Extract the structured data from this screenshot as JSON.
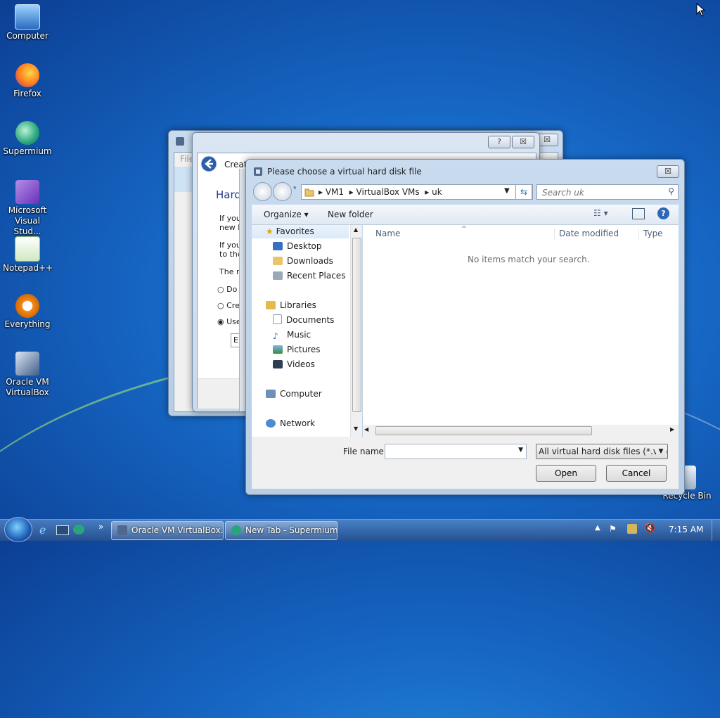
{
  "desktop": {
    "icons": [
      {
        "label": "Computer"
      },
      {
        "label": "Firefox"
      },
      {
        "label": "Supermium"
      },
      {
        "label": "Microsoft Visual Stud..."
      },
      {
        "label": "Notepad++"
      },
      {
        "label": "Everything"
      },
      {
        "label": "Oracle VM VirtualBox"
      },
      {
        "label": "Recycle Bin"
      }
    ]
  },
  "back_window": {
    "title": "Create",
    "heading": "Hard",
    "text_1a": "If you",
    "text_1b": "new h",
    "text_2a": "If you",
    "text_2b": "to the",
    "text_3": "The re",
    "radio_1": "Do",
    "radio_2": "Cre",
    "radio_3": "Use",
    "button_partial": "Em",
    "help": "?",
    "close": "☒",
    "menu_partial": "File"
  },
  "dialog": {
    "title": "Please choose a virtual hard disk file",
    "close": "☒",
    "breadcrumb": [
      "VM1",
      "VirtualBox VMs",
      "uk"
    ],
    "search_placeholder": "Search uk",
    "toolbar": {
      "organize": "Organize ▾",
      "new_folder": "New folder"
    },
    "nav": {
      "favorites": "Favorites",
      "desktop": "Desktop",
      "downloads": "Downloads",
      "recent": "Recent Places",
      "libraries": "Libraries",
      "documents": "Documents",
      "music": "Music",
      "pictures": "Pictures",
      "videos": "Videos",
      "computer": "Computer",
      "network": "Network"
    },
    "columns": {
      "name": "Name",
      "date": "Date modified",
      "type": "Type"
    },
    "empty_message": "No items match your search.",
    "filename_label": "File name:",
    "filename_value": "",
    "filter": "All virtual hard disk files (*.vmd",
    "open": "Open",
    "cancel": "Cancel"
  },
  "taskbar": {
    "apps": [
      {
        "label": "Oracle VM VirtualBox..."
      },
      {
        "label": "New Tab - Supermium"
      }
    ],
    "clock": "7:15 AM",
    "show_more": "»"
  },
  "colors": {
    "accent": "#1667c4",
    "window_frame": "#b7cde4"
  }
}
